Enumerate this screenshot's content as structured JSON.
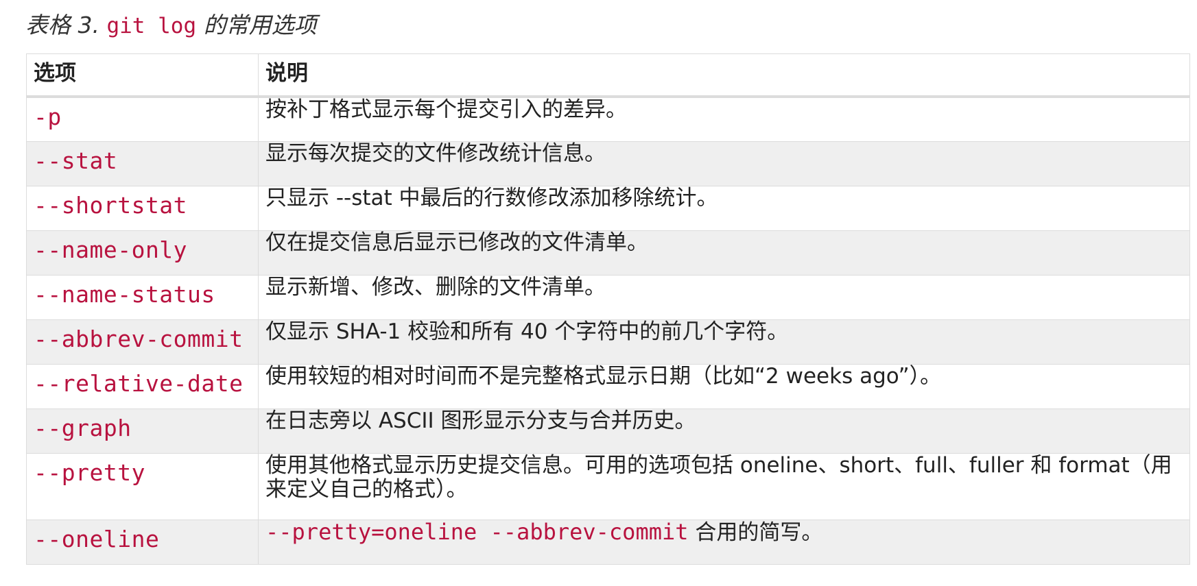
{
  "caption": {
    "prefix": "表格 3. ",
    "code": "git log",
    "suffix": " 的常用选项"
  },
  "table": {
    "headers": {
      "option": "选项",
      "description": "说明"
    },
    "rows": [
      {
        "option": "-p",
        "description": "按补丁格式显示每个提交引入的差异。"
      },
      {
        "option": "--stat",
        "description": "显示每次提交的文件修改统计信息。"
      },
      {
        "option": "--shortstat",
        "description": "只显示 --stat 中最后的行数修改添加移除统计。"
      },
      {
        "option": "--name-only",
        "description": "仅在提交信息后显示已修改的文件清单。"
      },
      {
        "option": "--name-status",
        "description": "显示新增、修改、删除的文件清单。"
      },
      {
        "option": "--abbrev-commit",
        "description": "仅显示 SHA-1 校验和所有 40 个字符中的前几个字符。"
      },
      {
        "option": "--relative-date",
        "description": "使用较短的相对时间而不是完整格式显示日期（比如“2 weeks ago”）。"
      },
      {
        "option": "--graph",
        "description": "在日志旁以 ASCII 图形显示分支与合并历史。"
      },
      {
        "option": "--pretty",
        "description": "使用其他格式显示历史提交信息。可用的选项包括 oneline、short、full、fuller 和 format（用来定义自己的格式）。"
      },
      {
        "option": "--oneline",
        "description_code": "--pretty=oneline --abbrev-commit",
        "description_suffix": " 合用的简写。"
      }
    ]
  },
  "colors": {
    "code": "#b8123f",
    "row_alt": "#efefef",
    "border": "#dcdcdc"
  }
}
